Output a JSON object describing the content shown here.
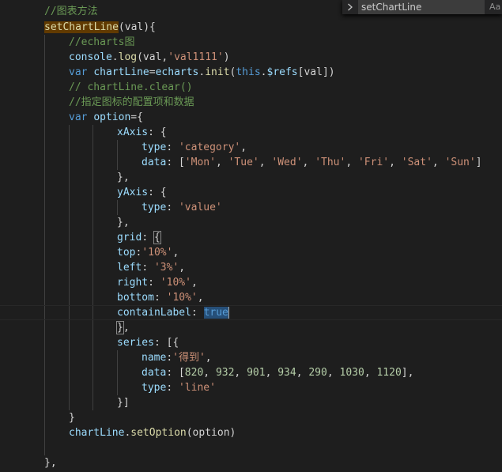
{
  "find_widget": {
    "toggle_icon": "chevron-right-icon",
    "search_value": "setChartLine",
    "match_case_label": "Aa"
  },
  "colors": {
    "background": "#1e1e1e",
    "comment": "#6a9955",
    "function": "#dcdcaa",
    "variable": "#9cdcfe",
    "keyword": "#569cd6",
    "string": "#ce9178",
    "number": "#b5cea8",
    "find_match_highlight": "#613a00",
    "selection": "#264f78"
  },
  "code": {
    "l01": {
      "comment": "//图表方法"
    },
    "l02": {
      "fn": "setChartLine",
      "rest": "(val){"
    },
    "l03": {
      "comment": "//echarts图"
    },
    "l04": {
      "obj": "console",
      "dot": ".",
      "fn": "log",
      "p1": "(val,",
      "str": "'val1111'",
      "p2": ")"
    },
    "l05": {
      "kw": "var",
      "var": "chartLine",
      "eq": "=",
      "obj": "echarts",
      "dot": ".",
      "fn": "init",
      "p1": "(",
      "kw2": "this",
      "dot2": ".",
      "refs": "$refs",
      "p2": "[val])"
    },
    "l06": {
      "comment": "// chartLine.clear()"
    },
    "l07": {
      "comment": "//指定图标的配置项和数据"
    },
    "l08": {
      "kw": "var",
      "var": "option",
      "rest": "={"
    },
    "l09": {
      "key": "xAxis",
      "rest": ": {"
    },
    "l10": {
      "key": "type",
      "colon": ": ",
      "str": "'category'",
      "comma": ","
    },
    "l11": {
      "key": "data",
      "open": ": [",
      "items": [
        "'Mon'",
        "'Tue'",
        "'Wed'",
        "'Thu'",
        "'Fri'",
        "'Sat'",
        "'Sun'"
      ],
      "sep": ", ",
      "close": "]"
    },
    "l12": {
      "text": "},"
    },
    "l13": {
      "key": "yAxis",
      "rest": ": {"
    },
    "l14": {
      "key": "type",
      "colon": ": ",
      "str": "'value'"
    },
    "l15": {
      "text": "},"
    },
    "l16": {
      "key": "grid",
      "colon": ": ",
      "brace": "{"
    },
    "l17": {
      "key": "top",
      "colon": ":",
      "str": "'10%'",
      "comma": ","
    },
    "l18": {
      "key": "left",
      "colon": ": ",
      "str": "'3%'",
      "comma": ","
    },
    "l19": {
      "key": "right",
      "colon": ": ",
      "str": "'10%'",
      "comma": ","
    },
    "l20": {
      "key": "bottom",
      "colon": ": ",
      "str": "'10%'",
      "comma": ","
    },
    "l21": {
      "key": "containLabel",
      "colon": ": ",
      "val": "true"
    },
    "l22": {
      "brace": "}",
      "comma": ","
    },
    "l23": {
      "key": "series",
      "rest": ": [{"
    },
    "l24": {
      "key": "name",
      "colon": ":",
      "str": "'得到'",
      "comma": ","
    },
    "l25": {
      "key": "data",
      "open": ": [",
      "items": [
        "820",
        "932",
        "901",
        "934",
        "290",
        "1030",
        "1120"
      ],
      "sep": ", ",
      "close": "],"
    },
    "l26": {
      "key": "type",
      "colon": ": ",
      "str": "'line'"
    },
    "l27": {
      "text": "}]"
    },
    "l28": {
      "text": "}"
    },
    "l29": {
      "obj": "chartLine",
      "dot": ".",
      "fn": "setOption",
      "rest": "(option)"
    },
    "l31": {
      "text": "},"
    }
  }
}
